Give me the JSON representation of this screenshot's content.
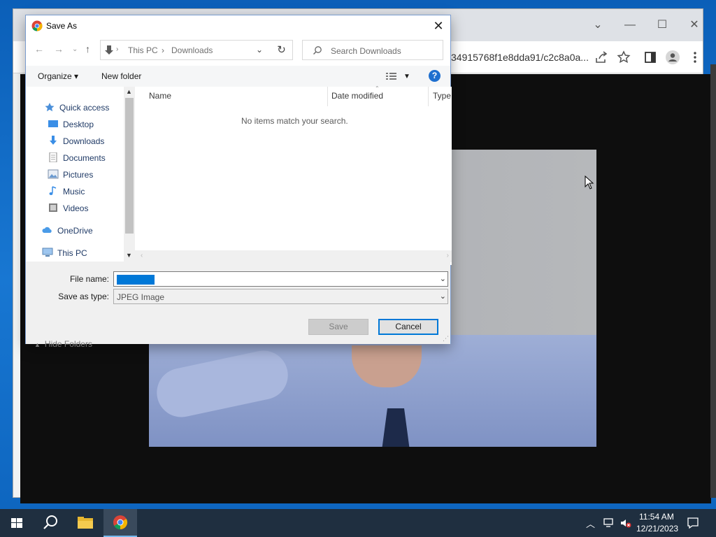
{
  "browser": {
    "url_fragment": "34915768f1e8dda91/c2c8a0a..."
  },
  "dialog": {
    "title": "Save As",
    "address": {
      "root": "This PC",
      "separator": "›",
      "folder": "Downloads"
    },
    "search_placeholder": "Search Downloads",
    "toolbar": {
      "organize": "Organize",
      "new_folder": "New folder"
    },
    "nav_items": [
      {
        "label": "Quick access",
        "icon": "star-icon"
      },
      {
        "label": "Desktop",
        "icon": "desktop-folder-icon",
        "pinned": true
      },
      {
        "label": "Downloads",
        "icon": "download-arrow-icon",
        "pinned": true
      },
      {
        "label": "Documents",
        "icon": "document-icon",
        "pinned": true
      },
      {
        "label": "Pictures",
        "icon": "pictures-icon",
        "pinned": true
      },
      {
        "label": "Music",
        "icon": "music-note-icon"
      },
      {
        "label": "Videos",
        "icon": "film-icon"
      },
      {
        "label": "OneDrive",
        "icon": "cloud-icon"
      },
      {
        "label": "This PC",
        "icon": "computer-icon"
      }
    ],
    "columns": [
      "Name",
      "Date modified",
      "Type"
    ],
    "empty_message": "No items match your search.",
    "file_name_label": "File name:",
    "file_name_value": "unnamed",
    "save_type_label": "Save as type:",
    "save_type_value": "JPEG Image",
    "hide_folders": "Hide Folders",
    "save_button": "Save",
    "cancel_button": "Cancel"
  },
  "taskbar": {
    "time": "11:54 AM",
    "date": "12/21/2023"
  },
  "colors": {
    "accent": "#0078d7",
    "taskbar": "#1f2f40",
    "desktop": "#0b5fb8"
  }
}
